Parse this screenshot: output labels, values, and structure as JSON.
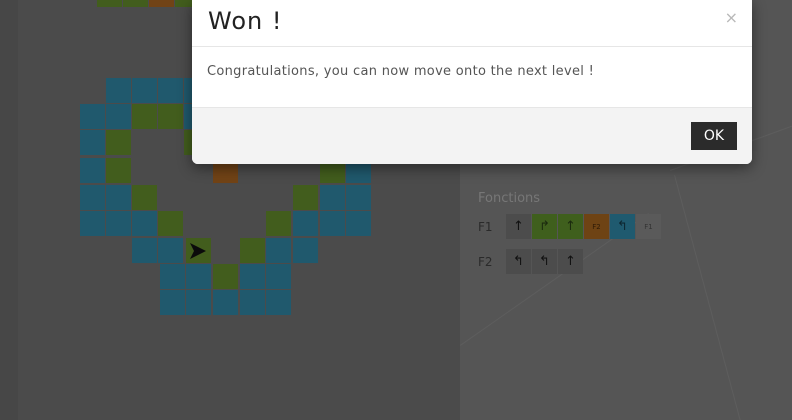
{
  "modal": {
    "title": "Won !",
    "close_symbol": "×",
    "message": "Congratulations, you can now move onto the next level !",
    "ok_label": "OK"
  },
  "functions": {
    "title": "Fonctions",
    "rows": [
      {
        "label": "F1",
        "cells": [
          {
            "icon": "arrow-up-icon",
            "glyph": "↑",
            "color": "none"
          },
          {
            "icon": "turn-right-icon",
            "glyph": "↱",
            "color": "green"
          },
          {
            "icon": "arrow-up-icon",
            "glyph": "↑",
            "color": "green"
          },
          {
            "icon": "call-f2",
            "glyph": "F2",
            "color": "orange"
          },
          {
            "icon": "turn-left-icon",
            "glyph": "↰",
            "color": "blue"
          },
          {
            "icon": "call-f1",
            "glyph": "F1",
            "color": "empty"
          }
        ]
      },
      {
        "label": "F2",
        "cells": [
          {
            "icon": "turn-left-icon",
            "glyph": "↰",
            "color": "none"
          },
          {
            "icon": "turn-left-icon",
            "glyph": "↰",
            "color": "none"
          },
          {
            "icon": "arrow-up-icon",
            "glyph": "↑",
            "color": "none"
          }
        ]
      }
    ]
  },
  "colors": {
    "blue_tile": "#3fb4d9",
    "green_tile": "#8cc63f",
    "orange_tile": "#f08a24",
    "ok_button": "#2b2b2b"
  }
}
